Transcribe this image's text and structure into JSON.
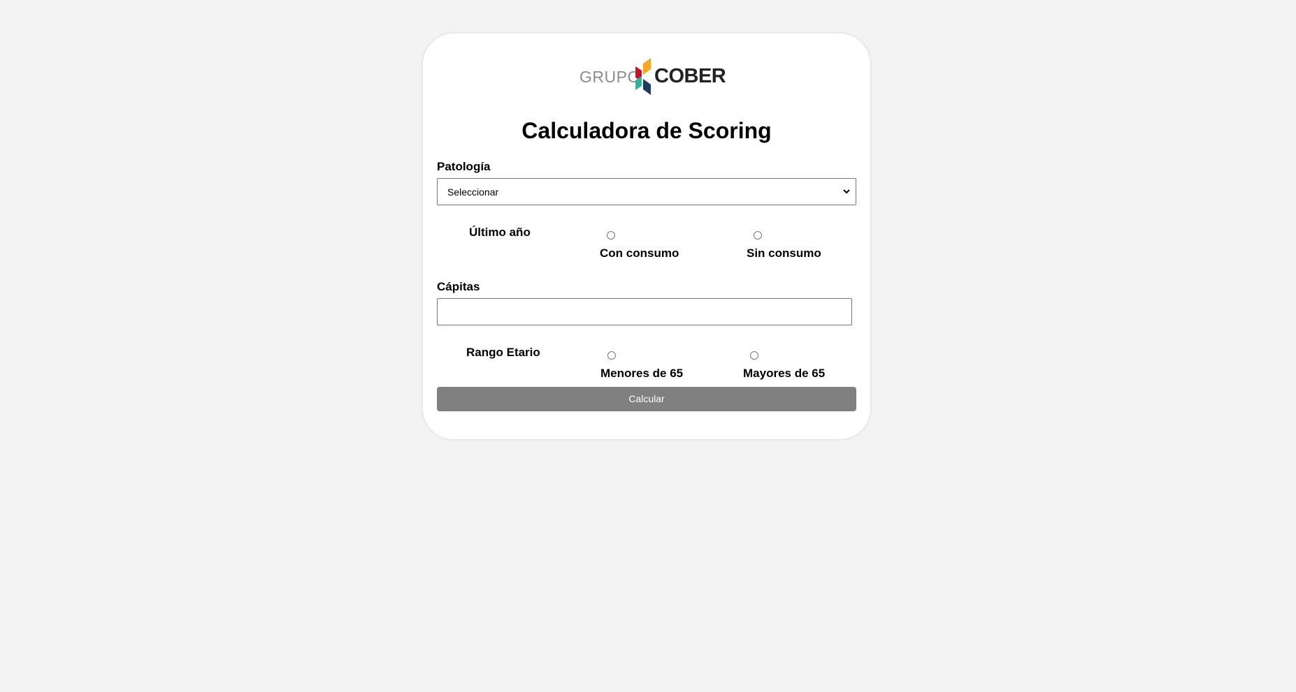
{
  "brand": {
    "grupo": "GRUPO",
    "cober": "COBER",
    "colors": {
      "orange": "#f5a623",
      "red": "#c8102e",
      "teal": "#2bb5a0",
      "navy": "#1f3a5f"
    }
  },
  "title": "Calculadora de Scoring",
  "patologia": {
    "label": "Patología",
    "selected": "Seleccionar"
  },
  "ultimo_anio": {
    "label": "Último año",
    "options": [
      "Con consumo",
      "Sin consumo"
    ]
  },
  "capitas": {
    "label": "Cápitas",
    "value": ""
  },
  "rango_etario": {
    "label": "Rango Etario",
    "options": [
      "Menores de 65",
      "Mayores de 65"
    ]
  },
  "calcular_label": "Calcular",
  "colors": {
    "background": "#f3f3f3",
    "button": "#808080"
  }
}
